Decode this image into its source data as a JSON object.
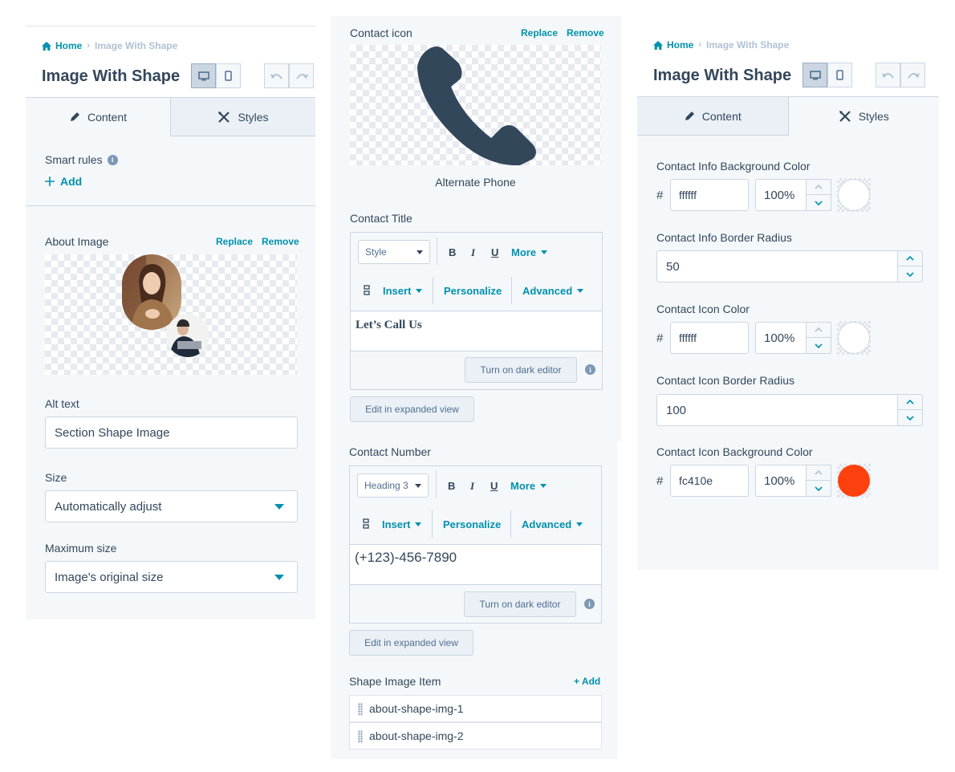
{
  "left": {
    "breadcrumb": {
      "home": "Home",
      "current": "Image With Shape"
    },
    "title": "Image With Shape",
    "tabs": {
      "content": "Content",
      "styles": "Styles"
    },
    "smart_rules": {
      "label": "Smart rules",
      "add": "Add"
    },
    "about_image": {
      "label": "About Image",
      "replace": "Replace",
      "remove": "Remove"
    },
    "alt_text": {
      "label": "Alt text",
      "value": "Section Shape Image"
    },
    "size": {
      "label": "Size",
      "value": "Automatically adjust"
    },
    "max_size": {
      "label": "Maximum size",
      "value": "Image's original size"
    }
  },
  "middle": {
    "contact_icon": {
      "label": "Contact icon",
      "replace": "Replace",
      "remove": "Remove",
      "caption": "Alternate Phone"
    },
    "contact_title": {
      "label": "Contact Title",
      "style_select": "Style",
      "bold": "B",
      "italic": "I",
      "underline": "U",
      "more": "More",
      "insert": "Insert",
      "personalize": "Personalize",
      "advanced": "Advanced",
      "content": "Let’s Call Us",
      "dark_editor": "Turn on dark editor",
      "expanded": "Edit in expanded view"
    },
    "contact_number": {
      "label": "Contact Number",
      "style_select": "Heading 3",
      "bold": "B",
      "italic": "I",
      "underline": "U",
      "more": "More",
      "insert": "Insert",
      "personalize": "Personalize",
      "advanced": "Advanced",
      "content": "(+123)-456-7890",
      "dark_editor": "Turn on dark editor",
      "expanded": "Edit in expanded view"
    },
    "shape_items": {
      "label": "Shape Image Item",
      "add": "+ Add",
      "items": [
        "about-shape-img-1",
        "about-shape-img-2"
      ]
    }
  },
  "right": {
    "breadcrumb": {
      "home": "Home",
      "current": "Image With Shape"
    },
    "title": "Image With Shape",
    "tabs": {
      "content": "Content",
      "styles": "Styles"
    },
    "info_bg": {
      "label": "Contact Info Background Color",
      "hash": "#",
      "hex": "ffffff",
      "opacity": "100%",
      "color": "#ffffff"
    },
    "info_radius": {
      "label": "Contact Info Border Radius",
      "value": "50"
    },
    "icon_color": {
      "label": "Contact Icon Color",
      "hash": "#",
      "hex": "ffffff",
      "opacity": "100%",
      "color": "#ffffff"
    },
    "icon_radius": {
      "label": "Contact Icon Border Radius",
      "value": "100"
    },
    "icon_bg": {
      "label": "Contact Icon Background Color",
      "hash": "#",
      "hex": "fc410e",
      "opacity": "100%",
      "color": "#fc410e"
    }
  },
  "icons": [
    "home-icon",
    "desktop-icon",
    "mobile-icon",
    "undo-icon",
    "redo-icon",
    "pencil-icon",
    "styles-icon",
    "info-icon",
    "plus-icon",
    "phone-icon",
    "drag-handle-icon",
    "chevron-up-icon",
    "chevron-down-icon"
  ]
}
